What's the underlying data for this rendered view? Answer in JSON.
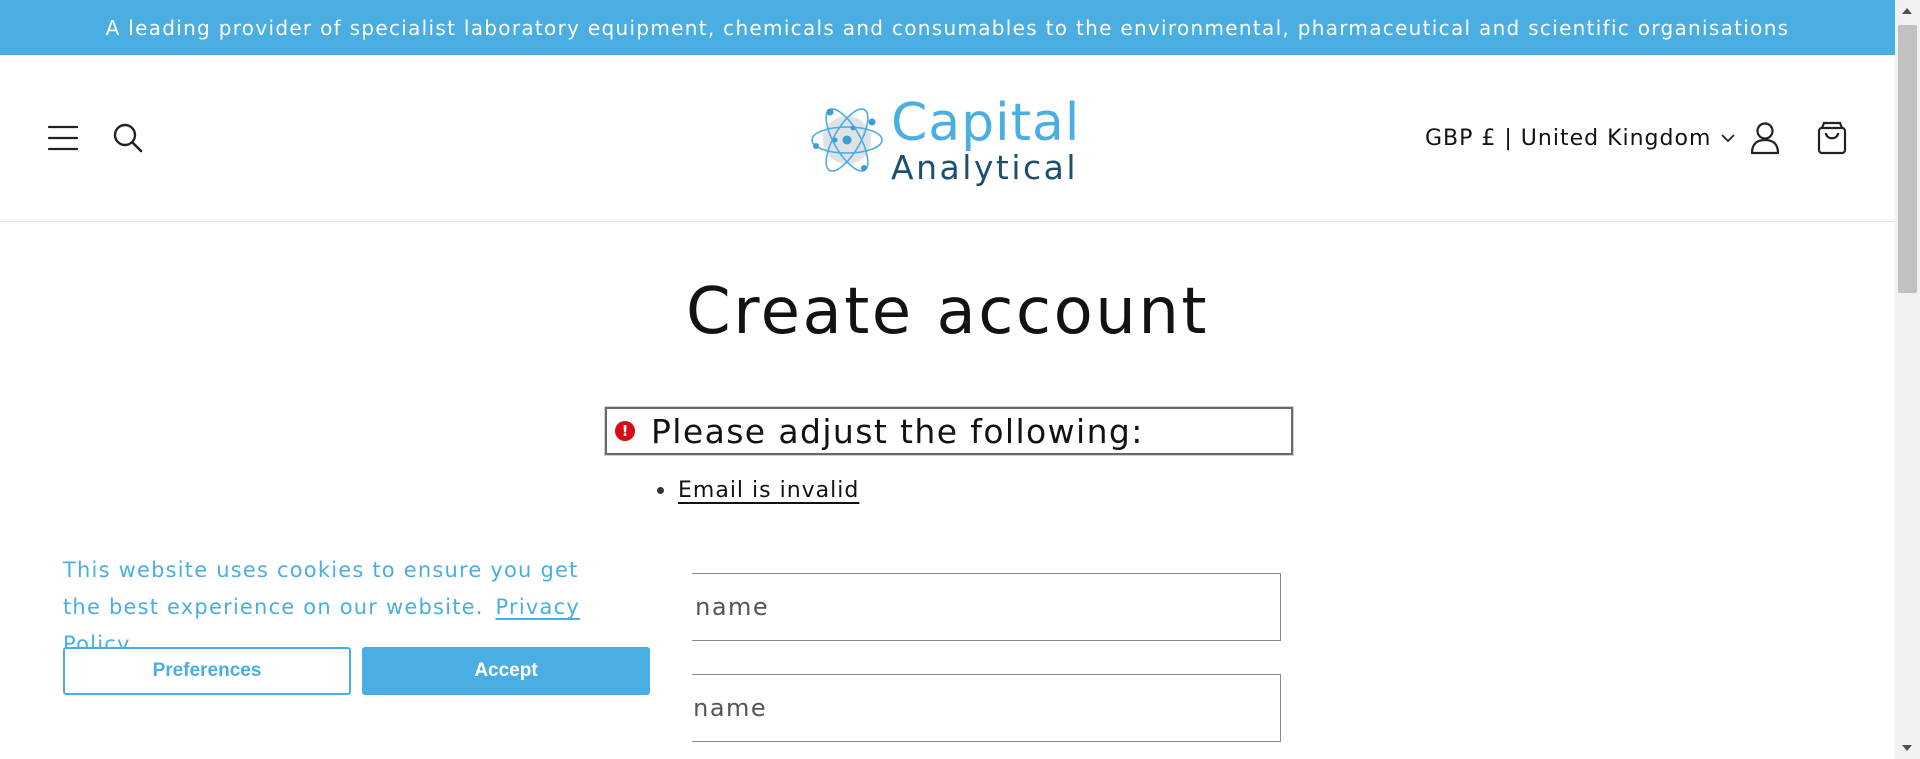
{
  "announcement": "A leading provider of specialist laboratory equipment, chemicals and consumables to the environmental, pharmaceutical and scientific organisations",
  "header": {
    "logo": {
      "line1": "Capital",
      "line2": "Analytical"
    },
    "country_selector": "GBP £ | United Kingdom",
    "icons": [
      "menu-icon",
      "search-icon",
      "chevron-down-icon",
      "account-icon",
      "cart-icon"
    ]
  },
  "main": {
    "title": "Create account",
    "error": {
      "icon": "!",
      "heading": "Please adjust the following:",
      "items": [
        "Email is invalid"
      ]
    },
    "fields": {
      "first_name_placeholder": "First name",
      "last_name_placeholder": "Last name"
    }
  },
  "cookie_banner": {
    "message": "This website uses cookies to ensure you get the best experience on our website.",
    "link": "Privacy Policy",
    "preferences_label": "Preferences",
    "accept_label": "Accept"
  },
  "colors": {
    "brand_blue": "#4aaee2",
    "brand_dark": "#1f4f6e",
    "error_red": "#d70a15"
  }
}
